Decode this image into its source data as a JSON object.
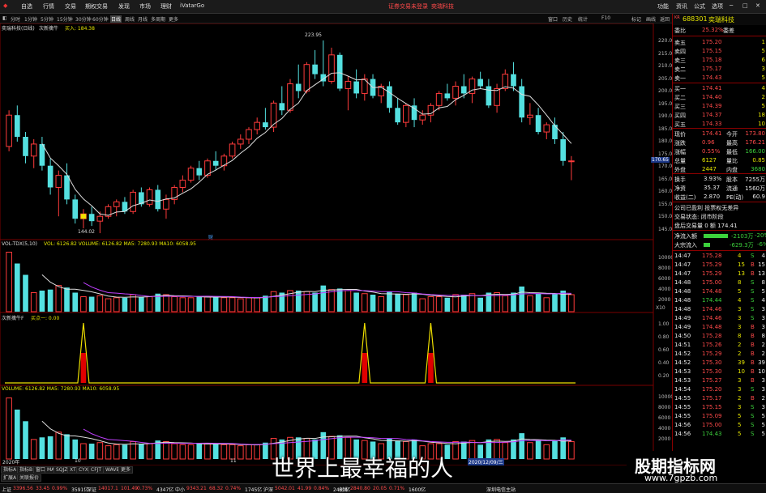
{
  "menu": {
    "items": [
      "自选",
      "行情",
      "交易",
      "期权交易",
      "发现",
      "市场",
      "理财",
      "iVatarGo"
    ],
    "center_items": [
      "证券交易未登录",
      "奕瑞科技"
    ],
    "right_items": [
      "功能",
      "资讯",
      "公式",
      "选项"
    ]
  },
  "timeframes": {
    "items": [
      "分时",
      "1分钟",
      "5分钟",
      "15分钟",
      "30分钟",
      "60分钟",
      "日线",
      "周线",
      "月线",
      "多周期",
      "更多"
    ],
    "active": "日线",
    "tools": [
      "窗口",
      "历史",
      "统计",
      "F10",
      "标记",
      "画线",
      "返回"
    ]
  },
  "chart_header": {
    "stock": "奕瑞科技(日线)",
    "indicator": "次新擒牛",
    "buy_label": "买入: 184.38",
    "high_label": "223.95",
    "low_label": "144.02",
    "crosshair_price": "170.65",
    "marker": "财"
  },
  "price_axis": [
    "220.0",
    "215.0",
    "210.0",
    "205.0",
    "200.0",
    "195.0",
    "190.0",
    "185.0",
    "180.0",
    "175.0",
    "170.0",
    "165.0",
    "160.0",
    "155.0",
    "150.0",
    "145.0"
  ],
  "vol_panel": {
    "label": "VOL-TDX(5,10)",
    "values": "VOL: 6126.82  VOLUME: 6126.82  MA5: 7280.93  MA10: 6058.95",
    "axis": [
      "10000",
      "8000",
      "6000",
      "4000",
      "2000"
    ],
    "unit": "X10"
  },
  "signal_panel": {
    "label": "次新擒牛F",
    "value": "买点一: 0.00",
    "axis": [
      "1.00",
      "0.80",
      "0.60",
      "0.40",
      "0.20"
    ]
  },
  "volume_panel": {
    "values": "VOLUME: 6126.82  MA5: 7280.93  MA10: 6058.95",
    "axis": [
      "10000",
      "8000",
      "6000",
      "4000",
      "2000"
    ],
    "date_left": "2020年",
    "date_mid1": "10",
    "date_mid2": "11",
    "date_right": "2020/12/09/三"
  },
  "bottom_tabs": [
    "指标A",
    "指标B",
    "窗口",
    "MA",
    "SQJZ",
    "XT",
    "CYX",
    "CFJT",
    "WAVE",
    "更多"
  ],
  "bottom_tabs2": [
    "扩展A",
    "关联报价"
  ],
  "quote": {
    "code": "688301",
    "name": "奕瑞科技",
    "weibi_label": "委比",
    "weibi": "25.32%",
    "weicha_label": "委差",
    "weicha": "",
    "sells": [
      {
        "label": "卖五",
        "price": "175.20",
        "vol": "1"
      },
      {
        "label": "卖四",
        "price": "175.15",
        "vol": "5"
      },
      {
        "label": "卖三",
        "price": "175.18",
        "vol": "6"
      },
      {
        "label": "卖二",
        "price": "175.17",
        "vol": "3"
      },
      {
        "label": "卖一",
        "price": "174.43",
        "vol": "5"
      }
    ],
    "buys": [
      {
        "label": "买一",
        "price": "174.41",
        "vol": "4"
      },
      {
        "label": "买二",
        "price": "174.40",
        "vol": "2"
      },
      {
        "label": "买三",
        "price": "174.39",
        "vol": "5"
      },
      {
        "label": "买四",
        "price": "174.37",
        "vol": "18"
      },
      {
        "label": "买五",
        "price": "174.33",
        "vol": "10"
      }
    ],
    "stats": [
      {
        "l1": "现价",
        "v1": "174.41",
        "l2": "今开",
        "v2": "173.80"
      },
      {
        "l1": "涨跌",
        "v1": "0.96",
        "l2": "最高",
        "v2": "176.21"
      },
      {
        "l1": "涨幅",
        "v1": "0.55%",
        "l2": "最低",
        "v2": "166.00"
      },
      {
        "l1": "总量",
        "v1": "6127",
        "l2": "量比",
        "v2": "0.85"
      },
      {
        "l1": "外盘",
        "v1": "2447",
        "l2": "内盘",
        "v2": "3680"
      }
    ],
    "stats2": [
      {
        "l1": "换手",
        "v1": "3.93%",
        "l2": "股本",
        "v2": "7255万"
      },
      {
        "l1": "净资",
        "v1": "35.37",
        "l2": "流通",
        "v2": "1560万"
      },
      {
        "l1": "收益(二)",
        "v1": "2.870",
        "l2": "PE(动)",
        "v2": "60.9"
      }
    ],
    "notes": [
      "公司已盈利 投票权无差异",
      "交易状态: 闭市阶段",
      "盘后交易量 0 额 174.41"
    ],
    "flow": [
      {
        "label": "净流入额",
        "value": "-2103万",
        "pct": "-20%"
      },
      {
        "label": "大宗流入",
        "value": "-629.3万",
        "pct": "-6%"
      }
    ],
    "ticks": [
      {
        "t": "14:47",
        "p": "175.28",
        "v": "4",
        "s": "S"
      },
      {
        "t": "14:47",
        "p": "175.29",
        "v": "15",
        "s": "B"
      },
      {
        "t": "14:47",
        "p": "175.29",
        "v": "13",
        "s": "B"
      },
      {
        "t": "14:48",
        "p": "175.00",
        "v": "8",
        "s": "S"
      },
      {
        "t": "14:48",
        "p": "174.48",
        "v": "5",
        "s": "S"
      },
      {
        "t": "14:48",
        "p": "174.44",
        "v": "4",
        "s": "S"
      },
      {
        "t": "14:48",
        "p": "174.46",
        "v": "3",
        "s": "S"
      },
      {
        "t": "14:49",
        "p": "174.46",
        "v": "3",
        "s": "S"
      },
      {
        "t": "14:49",
        "p": "174.48",
        "v": "3",
        "s": "B"
      },
      {
        "t": "14:50",
        "p": "175.28",
        "v": "8",
        "s": "B"
      },
      {
        "t": "14:51",
        "p": "175.26",
        "v": "2",
        "s": "B"
      },
      {
        "t": "14:52",
        "p": "175.29",
        "v": "2",
        "s": "B"
      },
      {
        "t": "14:52",
        "p": "175.30",
        "v": "39",
        "s": "B"
      },
      {
        "t": "14:53",
        "p": "175.30",
        "v": "10",
        "s": "B"
      },
      {
        "t": "14:53",
        "p": "175.27",
        "v": "3",
        "s": "B"
      },
      {
        "t": "14:54",
        "p": "175.20",
        "v": "3",
        "s": "S"
      },
      {
        "t": "14:55",
        "p": "175.17",
        "v": "2",
        "s": "B"
      },
      {
        "t": "14:55",
        "p": "175.15",
        "v": "3",
        "s": "S"
      },
      {
        "t": "14:55",
        "p": "175.09",
        "v": "5",
        "s": "S"
      },
      {
        "t": "14:56",
        "p": "175.00",
        "v": "5",
        "s": "S"
      },
      {
        "t": "14:56",
        "p": "174.43",
        "v": "5",
        "s": "S"
      }
    ]
  },
  "statusbar": [
    {
      "label": "上证",
      "value": "3396.56",
      "chg": "33.45",
      "pct": "0.99%",
      "amt": "3591亿"
    },
    {
      "label": "深证",
      "value": "14017.1",
      "chg": "101.49",
      "pct": "0.73%",
      "amt": "4347亿"
    },
    {
      "label": "中小",
      "value": "9343.21",
      "chg": "68.32",
      "pct": "0.74%",
      "amt": "1745亿"
    },
    {
      "label": "沪深",
      "value": "5042.01",
      "chg": "41.99",
      "pct": "0.84%",
      "amt": "2440亿"
    },
    {
      "label": "创业",
      "value": "2840.80",
      "chg": "20.05",
      "pct": "0.71%",
      "amt": "1600亿"
    }
  ],
  "statusbar_extra": "深圳电信主站",
  "subtitle": "世界上最幸福的人",
  "watermark": {
    "title": "股期指标网",
    "url": "www.7gpzb.com"
  },
  "candles": [
    [
      180,
      195,
      178,
      193
    ],
    [
      193,
      197,
      182,
      184
    ],
    [
      184,
      186,
      173,
      176
    ],
    [
      176,
      183,
      171,
      181
    ],
    [
      181,
      184,
      170,
      172
    ],
    [
      172,
      175,
      160,
      163
    ],
    [
      163,
      170,
      151,
      168
    ],
    [
      168,
      173,
      156,
      158
    ],
    [
      158,
      160,
      148,
      150
    ],
    [
      150,
      154,
      146,
      152
    ],
    [
      152,
      155,
      147,
      149
    ],
    [
      149,
      153,
      144,
      151
    ],
    [
      151,
      156,
      150,
      155
    ],
    [
      155,
      158,
      151,
      157
    ],
    [
      157,
      159,
      152,
      153
    ],
    [
      153,
      162,
      152,
      161
    ],
    [
      161,
      163,
      155,
      156
    ],
    [
      156,
      163,
      155,
      162
    ],
    [
      162,
      164,
      153,
      154
    ],
    [
      154,
      160,
      150,
      158
    ],
    [
      158,
      164,
      156,
      163
    ],
    [
      163,
      168,
      161,
      166
    ],
    [
      166,
      172,
      165,
      171
    ],
    [
      171,
      174,
      166,
      168
    ],
    [
      168,
      175,
      167,
      174
    ],
    [
      174,
      178,
      170,
      172
    ],
    [
      172,
      177,
      170,
      176
    ],
    [
      176,
      182,
      175,
      181
    ],
    [
      181,
      185,
      179,
      183
    ],
    [
      183,
      188,
      181,
      187
    ],
    [
      187,
      192,
      185,
      190
    ],
    [
      190,
      196,
      187,
      188
    ],
    [
      188,
      199,
      186,
      198
    ],
    [
      198,
      205,
      193,
      195
    ],
    [
      195,
      208,
      194,
      206
    ],
    [
      206,
      214,
      200,
      203
    ],
    [
      203,
      215,
      202,
      214
    ],
    [
      214,
      220,
      208,
      210
    ],
    [
      210,
      224,
      205,
      207
    ],
    [
      207,
      221,
      206,
      218
    ],
    [
      218,
      219,
      203,
      204
    ],
    [
      204,
      209,
      195,
      207
    ],
    [
      207,
      212,
      200,
      202
    ],
    [
      202,
      210,
      199,
      208
    ],
    [
      208,
      210,
      200,
      201
    ],
    [
      201,
      206,
      198,
      205
    ],
    [
      205,
      207,
      194,
      196
    ],
    [
      196,
      200,
      189,
      190
    ],
    [
      190,
      198,
      188,
      197
    ],
    [
      197,
      200,
      188,
      191
    ],
    [
      191,
      195,
      189,
      193
    ],
    [
      193,
      198,
      190,
      197
    ],
    [
      197,
      203,
      195,
      202
    ],
    [
      202,
      206,
      199,
      200
    ],
    [
      200,
      207,
      197,
      205
    ],
    [
      205,
      210,
      200,
      202
    ],
    [
      202,
      209,
      198,
      208
    ],
    [
      208,
      211,
      204,
      205
    ],
    [
      205,
      208,
      196,
      197
    ],
    [
      197,
      206,
      194,
      204
    ],
    [
      204,
      212,
      203,
      210
    ],
    [
      210,
      215,
      203,
      205
    ],
    [
      205,
      208,
      190,
      192
    ],
    [
      192,
      198,
      189,
      193
    ],
    [
      193,
      196,
      185,
      186
    ],
    [
      186,
      190,
      183,
      189
    ],
    [
      189,
      192,
      181,
      183
    ],
    [
      183,
      186,
      172,
      174
    ],
    [
      174,
      176,
      166,
      174
    ]
  ],
  "signal_positions": [
    9,
    43,
    51
  ]
}
